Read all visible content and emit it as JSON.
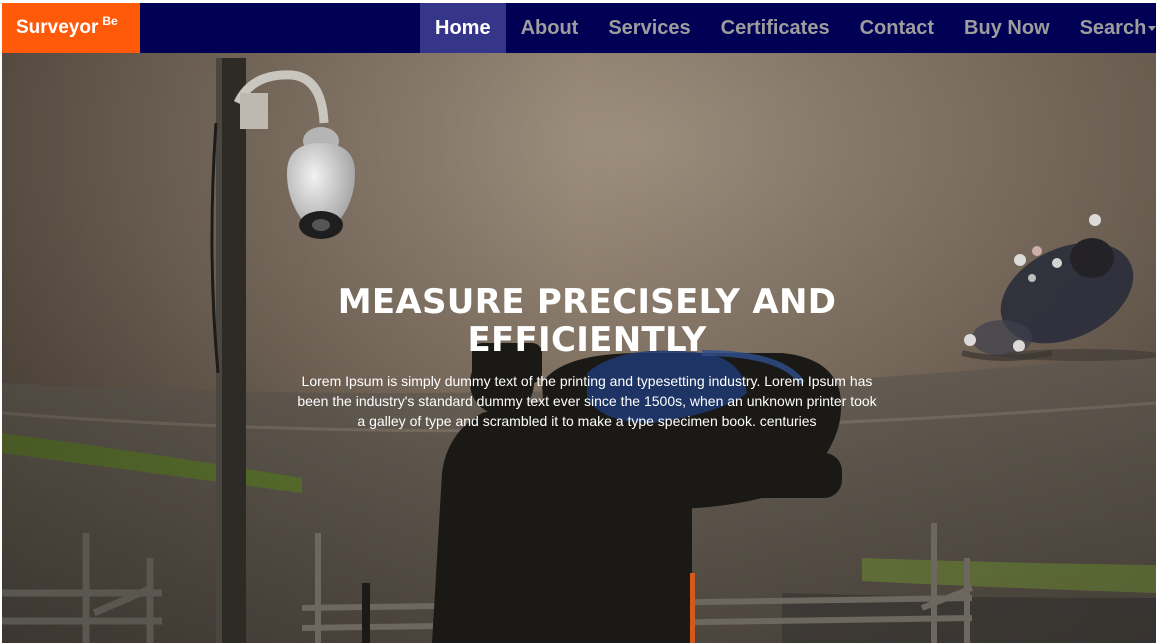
{
  "brand": {
    "name": "Surveyor",
    "superscript": "Be",
    "color": "#ff5a0a"
  },
  "nav": {
    "background": "#000055",
    "items": [
      {
        "label": "Home",
        "active": true
      },
      {
        "label": "About"
      },
      {
        "label": "Services"
      },
      {
        "label": "Certificates"
      },
      {
        "label": "Contact"
      },
      {
        "label": "Buy Now"
      },
      {
        "label": "Search",
        "dropdown": true
      }
    ]
  },
  "hero": {
    "title": "MEASURE PRECISELY AND EFFICIENTLY",
    "text": "Lorem Ipsum is simply dummy text of the printing and typesetting industry. Lorem Ipsum has been the industry's standard dummy text ever since the 1500s, when an unknown printer took a galley of type and scrambled it to make a type specimen book. centuries",
    "background_image": "racetrack with security camera pole, camera operator silhouette and blurred motorcycle rider"
  }
}
